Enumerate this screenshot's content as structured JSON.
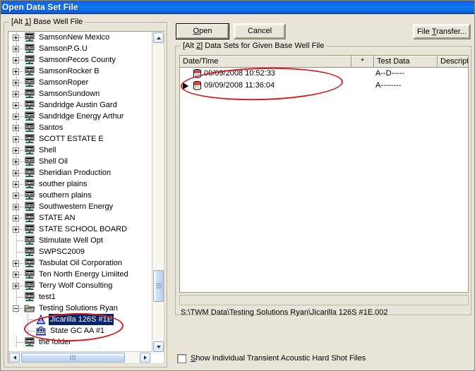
{
  "window": {
    "title": "Open Data Set File",
    "titlebar_color": "#0a70ec",
    "background_color": "#E9E5D9"
  },
  "toolbar": {
    "open_label": "Open",
    "open_accel": "O",
    "cancel_label": "Cancel",
    "file_transfer_label": "File Transfer...",
    "file_transfer_accel": "T"
  },
  "left_panel": {
    "group_label_prefix": "[Alt ",
    "group_accel": "1",
    "group_label_suffix": "]  Base Well File",
    "tree": [
      {
        "label": "SamsonNew Mexico",
        "expander": "plus",
        "icon": "well-file-icon",
        "level": 0,
        "selected": false
      },
      {
        "label": "SamsonP.G.U",
        "expander": "plus",
        "icon": "well-file-icon",
        "level": 0,
        "selected": false
      },
      {
        "label": "SamsonPecos County",
        "expander": "plus",
        "icon": "well-file-icon",
        "level": 0,
        "selected": false
      },
      {
        "label": "SamsonRocker B",
        "expander": "plus",
        "icon": "well-file-icon",
        "level": 0,
        "selected": false
      },
      {
        "label": "SamsonRoper",
        "expander": "plus",
        "icon": "well-file-icon",
        "level": 0,
        "selected": false
      },
      {
        "label": "SamsonSundown",
        "expander": "plus",
        "icon": "well-file-icon",
        "level": 0,
        "selected": false
      },
      {
        "label": "Sandridge Austin Gard",
        "expander": "plus",
        "icon": "well-file-icon",
        "level": 0,
        "selected": false
      },
      {
        "label": "Sandridge Energy Arthur",
        "expander": "plus",
        "icon": "well-file-icon",
        "level": 0,
        "selected": false
      },
      {
        "label": "Santos",
        "expander": "plus",
        "icon": "well-file-icon",
        "level": 0,
        "selected": false
      },
      {
        "label": "SCOTT ESTATE E",
        "expander": "plus",
        "icon": "well-file-icon",
        "level": 0,
        "selected": false
      },
      {
        "label": "Shell",
        "expander": "plus",
        "icon": "well-file-icon",
        "level": 0,
        "selected": false
      },
      {
        "label": "Shell Oil",
        "expander": "plus",
        "icon": "well-file-icon",
        "level": 0,
        "selected": false
      },
      {
        "label": "Sheridian Production",
        "expander": "plus",
        "icon": "well-file-icon",
        "level": 0,
        "selected": false
      },
      {
        "label": "souther plains",
        "expander": "plus",
        "icon": "well-file-icon",
        "level": 0,
        "selected": false
      },
      {
        "label": "southern plains",
        "expander": "plus",
        "icon": "well-file-icon",
        "level": 0,
        "selected": false
      },
      {
        "label": "Southwestern Energy",
        "expander": "plus",
        "icon": "well-file-icon",
        "level": 0,
        "selected": false
      },
      {
        "label": "STATE AN",
        "expander": "plus",
        "icon": "well-file-icon",
        "level": 0,
        "selected": false
      },
      {
        "label": "STATE SCHOOL BOARD",
        "expander": "plus",
        "icon": "well-file-icon",
        "level": 0,
        "selected": false
      },
      {
        "label": "Stimulate Well Opt",
        "expander": "none",
        "icon": "well-file-icon",
        "level": 0,
        "selected": false
      },
      {
        "label": "SWPSC2009",
        "expander": "none",
        "icon": "well-file-icon",
        "level": 0,
        "selected": false
      },
      {
        "label": "Tasbulat Oil Corporation",
        "expander": "plus",
        "icon": "well-file-icon",
        "level": 0,
        "selected": false
      },
      {
        "label": "Ten North Energy Limiited",
        "expander": "plus",
        "icon": "well-file-icon",
        "level": 0,
        "selected": false
      },
      {
        "label": "Terry Wolf Consulting",
        "expander": "plus",
        "icon": "well-file-icon",
        "level": 0,
        "selected": false
      },
      {
        "label": "test1",
        "expander": "none",
        "icon": "well-file-icon",
        "level": 0,
        "selected": false
      },
      {
        "label": "Testing Solutions Ryan",
        "expander": "minus",
        "icon": "open-folder-icon",
        "level": 0,
        "selected": false
      },
      {
        "label": "Jicarilla 126S #1E",
        "expander": "none",
        "icon": "well-derrick-icon",
        "level": 1,
        "selected": true
      },
      {
        "label": "State GC AA #1",
        "expander": "none",
        "icon": "well-rig-icon",
        "level": 1,
        "selected": false
      },
      {
        "label": "the folder",
        "expander": "none",
        "icon": "well-file-icon",
        "level": 0,
        "selected": false
      }
    ]
  },
  "right_panel": {
    "group_label_prefix": "[Alt ",
    "group_accel": "2",
    "group_label_suffix": "]  Data Sets for Given Base Well File",
    "columns": [
      {
        "label": "Date/Time",
        "key": "date_time"
      },
      {
        "label": "*",
        "key": "star"
      },
      {
        "label": "Test Data",
        "key": "test_data"
      },
      {
        "label": "Description",
        "key": "description"
      }
    ],
    "rows": [
      {
        "selected": false,
        "icon": "data-set-icon",
        "date_time": "09/09/2008  10:52:33",
        "star": "",
        "test_data": "A--D-----",
        "description": ""
      },
      {
        "selected": true,
        "icon": "data-set-icon",
        "date_time": "09/09/2008  11:36:04",
        "star": "",
        "test_data": "A--------",
        "description": ""
      }
    ],
    "file_path": "S:\\TWM Data\\Testing Solutions Ryan\\Jicarilla 126S #1E.002",
    "filter_value": ""
  },
  "footer": {
    "checkbox_label_accel": "S",
    "checkbox_label_rest": "how Individual Transient Acoustic Hard Shot Files",
    "checkbox_checked": false
  },
  "annotations": {
    "color": "#d41f1f",
    "items": [
      {
        "name": "tree-selection-ellipse"
      },
      {
        "name": "grid-rows-ellipse"
      }
    ]
  }
}
